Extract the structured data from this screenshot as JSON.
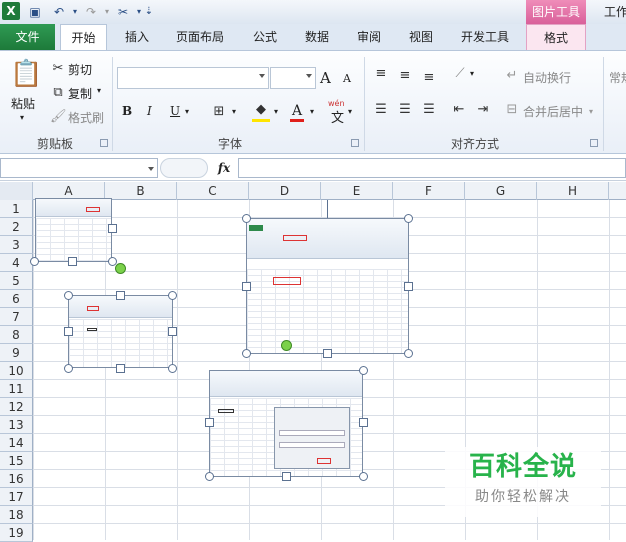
{
  "titlebar": {
    "picture_tools": "图片工具",
    "workbook_title": "工作",
    "app_icon": "excel-icon"
  },
  "tabs": {
    "file": "文件",
    "home": "开始",
    "insert": "插入",
    "page_layout": "页面布局",
    "formulas": "公式",
    "data": "数据",
    "review": "审阅",
    "view": "视图",
    "developer": "开发工具",
    "format": "格式"
  },
  "clipboard": {
    "paste": "粘贴",
    "cut": "剪切",
    "copy": "复制",
    "format_painter": "格式刷",
    "group": "剪贴板"
  },
  "font": {
    "group": "字体",
    "bold": "B",
    "italic": "I",
    "underline": "U",
    "grow": "A",
    "shrink": "A",
    "font_color": "A",
    "wen": "wén",
    "wen_char": "文"
  },
  "alignment": {
    "wrap_text": "自动换行",
    "merge_center": "合并后居中",
    "group": "对齐方式"
  },
  "number": {
    "general": "常规"
  },
  "formula": {
    "fx": "fx"
  },
  "columns": [
    "A",
    "B",
    "C",
    "D",
    "E",
    "F",
    "G",
    "H"
  ],
  "rows": [
    "1",
    "2",
    "3",
    "4",
    "5",
    "6",
    "7",
    "8",
    "9",
    "10",
    "11",
    "12",
    "13",
    "14",
    "15",
    "16",
    "17",
    "18",
    "19"
  ],
  "watermark": {
    "title": "百科全说",
    "subtitle": "助你轻松解决"
  }
}
